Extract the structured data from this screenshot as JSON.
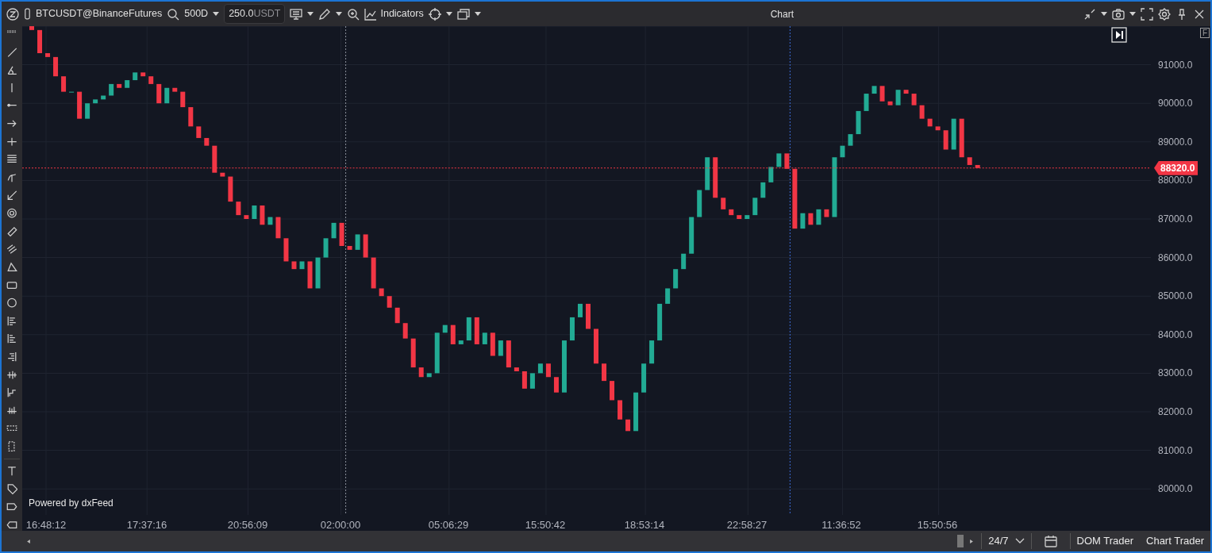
{
  "toolbar": {
    "symbol": "BTCUSDT@BinanceFutures",
    "period": "500D",
    "quantity": {
      "value": "250.0",
      "unit": "USDT"
    },
    "indicators": "Indicators",
    "title": "Chart"
  },
  "chart": {
    "flag": "F",
    "watermark": "Powered by dxFeed",
    "price_label": {
      "text": "88320.0",
      "color": "#f23645"
    },
    "price_axis": [
      "91000.0",
      "90000.0",
      "89000.0",
      "88000.0",
      "87000.0",
      "86000.0",
      "85000.0",
      "84000.0",
      "83000.0",
      "82000.0",
      "81000.0",
      "80000.0"
    ],
    "time_axis": [
      "16:48:12",
      "17:37:16",
      "20:56:09",
      "02:00:00",
      "05:06:29",
      "15:50:42",
      "18:53:14",
      "22:58:27",
      "11:36:52",
      "15:50:56"
    ]
  },
  "bottom_bar": {
    "session": "24/7",
    "buttons": [
      "DOM Trader",
      "Chart Trader"
    ]
  }
}
